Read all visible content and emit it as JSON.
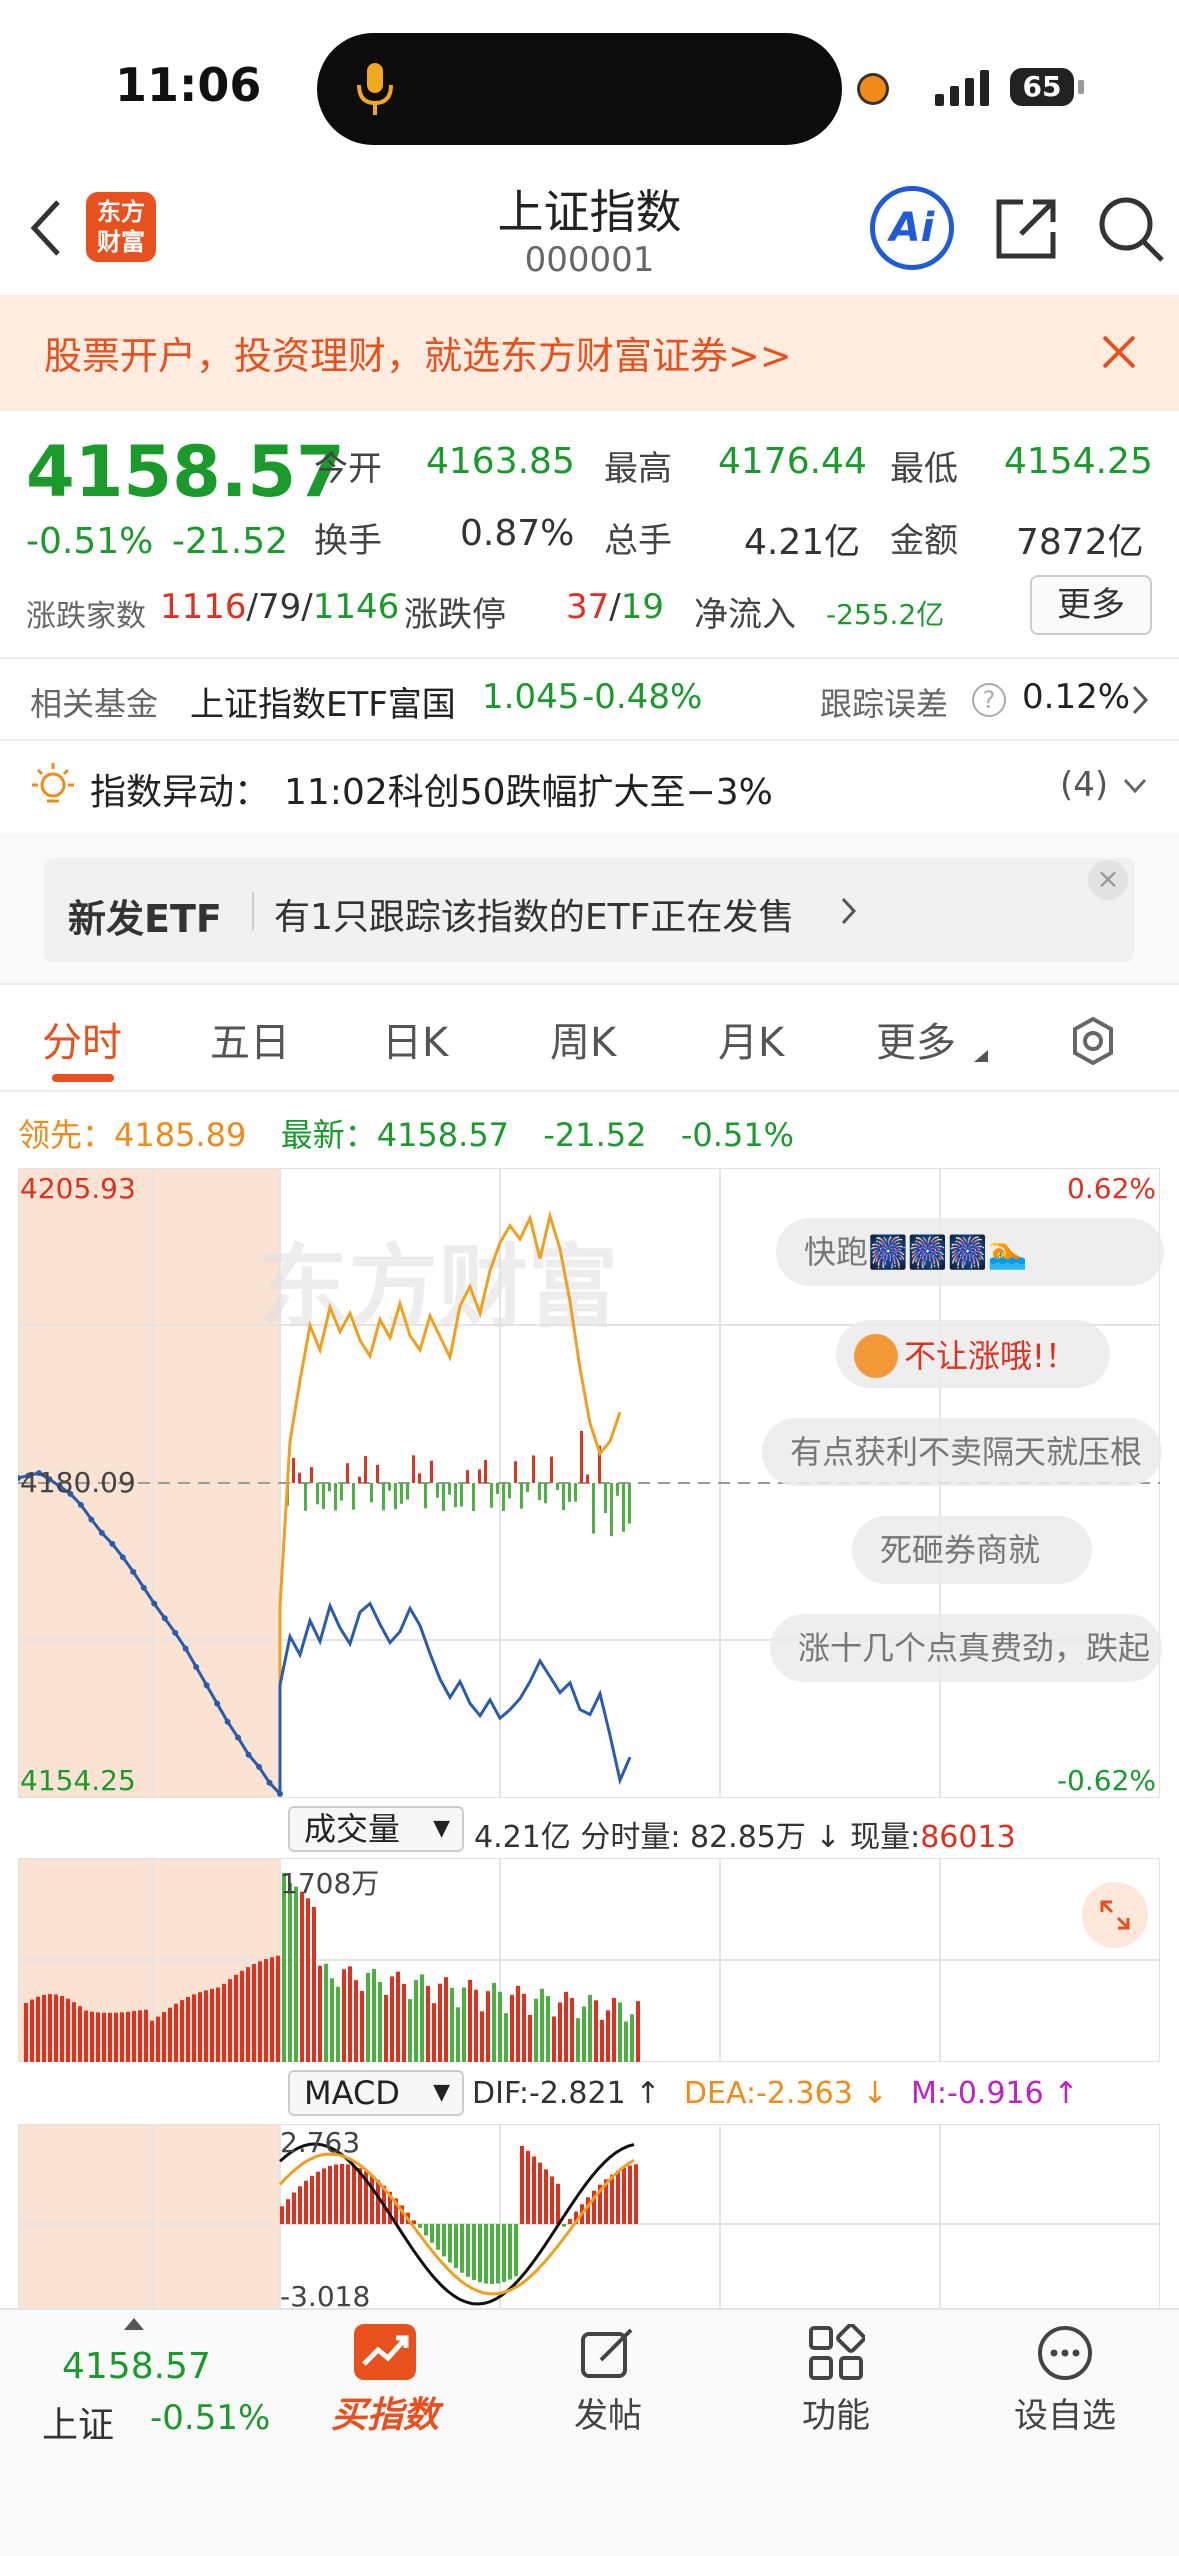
{
  "status_bar": {
    "time": "11:06",
    "battery": "65"
  },
  "nav": {
    "title": "上证指数",
    "code": "000001",
    "logo_text_1": "东方",
    "logo_text_2": "财富",
    "ai_label": "Ai"
  },
  "banner": {
    "text": "股票开户，投资理财，就选东方财富证券>>"
  },
  "quote": {
    "price": "4158.57",
    "change_pct": "-0.51%",
    "change": "-21.52",
    "open_label": "今开",
    "open": "4163.85",
    "high_label": "最高",
    "high": "4176.44",
    "low_label": "最低",
    "low": "4154.25",
    "turnover_label": "换手",
    "turnover": "0.87%",
    "volume_label": "总手",
    "volume": "4.21亿",
    "amount_label": "金额",
    "amount": "7872亿",
    "breadth_label": "涨跌家数",
    "up": "1116",
    "flat": "79",
    "down": "1146",
    "limit_label": "涨跌停",
    "limit_up": "37",
    "limit_down": "19",
    "inflow_label": "净流入",
    "inflow": "-255.2亿",
    "more_button": "更多"
  },
  "fund": {
    "label": "相关基金",
    "name": "上证指数ETF富国",
    "price": "1.045",
    "change": "-0.48%",
    "tracking_label": "跟踪误差",
    "tracking": "0.12%"
  },
  "alert": {
    "label": "指数异动：",
    "text": "11:02科创50跌幅扩大至−3%",
    "count": "(4)"
  },
  "etf_promo": {
    "title": "新发ETF",
    "text": "有1只跟踪该指数的ETF正在发售"
  },
  "tabs": [
    "分时",
    "五日",
    "日K",
    "周K",
    "月K",
    "更多"
  ],
  "info_line": {
    "lead_label": "领先：",
    "lead": "4185.89",
    "latest_label": "最新：",
    "latest": "4158.57",
    "change": "-21.52",
    "pct": "-0.51%"
  },
  "chart_labels": {
    "top": "4205.93",
    "mid": "4180.09",
    "bottom": "4154.25",
    "top_pct": "0.62%",
    "bottom_pct": "-0.62%",
    "watermark": "东方财富"
  },
  "danmaku": [
    "快跑🎆🎆🎆🏊",
    "不让涨哦!！",
    "有点获利不卖隔天就压根",
    "死砸券商就",
    "涨十几个点真费劲，跌起"
  ],
  "volume_bar": {
    "selector": "成交量",
    "total": "4.21亿",
    "minute_label": "分时量:",
    "minute": "82.85万 ↓",
    "now_label": "现量:",
    "now": "86013",
    "max": "1708万"
  },
  "macd_bar": {
    "selector": "MACD",
    "dif": "DIF:-2.821 ↑",
    "dea": "DEA:-2.363 ↓",
    "m": "M:-0.916 ↑",
    "max": "2.763",
    "min": "-3.018"
  },
  "bottom": {
    "index_price": "4158.57",
    "index_name": "上证",
    "index_pct": "-0.51%",
    "buy": "买指数",
    "post": "发帖",
    "func": "功能",
    "watch": "设自选"
  },
  "chart_data": {
    "type": "line",
    "title": "上证指数 分时",
    "ylim": [
      4154.25,
      4205.93
    ],
    "prev_close": 4180.09,
    "series": [
      {
        "name": "最新",
        "values": [
          4180.5,
          4180.7,
          4180.9,
          4180.4,
          4179.8,
          4179.2,
          4178.3,
          4177.1,
          4176.0,
          4175.1,
          4174.0,
          4172.8,
          4171.5,
          4170.2,
          4169.0,
          4167.8,
          4166.5,
          4165.0,
          4163.5,
          4162.0,
          4160.5,
          4159.2,
          4157.8,
          4156.8,
          4155.5,
          4154.6,
          4163.5,
          4167.5,
          4166.0,
          4168.8,
          4167.1,
          4170.0,
          4168.2,
          4166.9,
          4169.5,
          4170.2,
          4168.5,
          4167.0,
          4167.9,
          4169.8,
          4168.4,
          4166.1,
          4164.0,
          4162.5,
          4163.8,
          4162.0,
          4161.0,
          4162.3,
          4160.8,
          4161.5,
          4162.4,
          4163.8,
          4165.5,
          4164.2,
          4162.9,
          4163.7,
          4161.5,
          4161.1,
          4162.8,
          4159.4,
          4155.7,
          4157.6
        ]
      },
      {
        "name": "领先",
        "values": [
          4180.5,
          4180.7,
          4180.9,
          4180.4,
          4179.8,
          4179.2,
          4178.3,
          4177.1,
          4176.0,
          4175.1,
          4174.0,
          4172.8,
          4171.5,
          4170.2,
          4169.0,
          4167.8,
          4166.5,
          4165.0,
          4163.5,
          4162.0,
          4160.5,
          4159.2,
          4157.8,
          4156.8,
          4155.5,
          4154.6,
          4170.0,
          4183.5,
          4188.5,
          4193.0,
          4191.0,
          4194.5,
          4192.5,
          4194.0,
          4191.8,
          4190.5,
          4193.5,
          4192.0,
          4194.8,
          4192.2,
          4191.0,
          4193.8,
          4192.1,
          4190.4,
          4194.6,
          4196.2,
          4194.0,
          4197.5,
          4199.8,
          4201.2,
          4200.1,
          4201.8,
          4198.5,
          4202.0,
          4199.3,
          4195.0,
          4189.5,
          4185.0,
          4182.5,
          4183.5,
          4185.9
        ]
      }
    ],
    "volume_max": "1708万"
  }
}
